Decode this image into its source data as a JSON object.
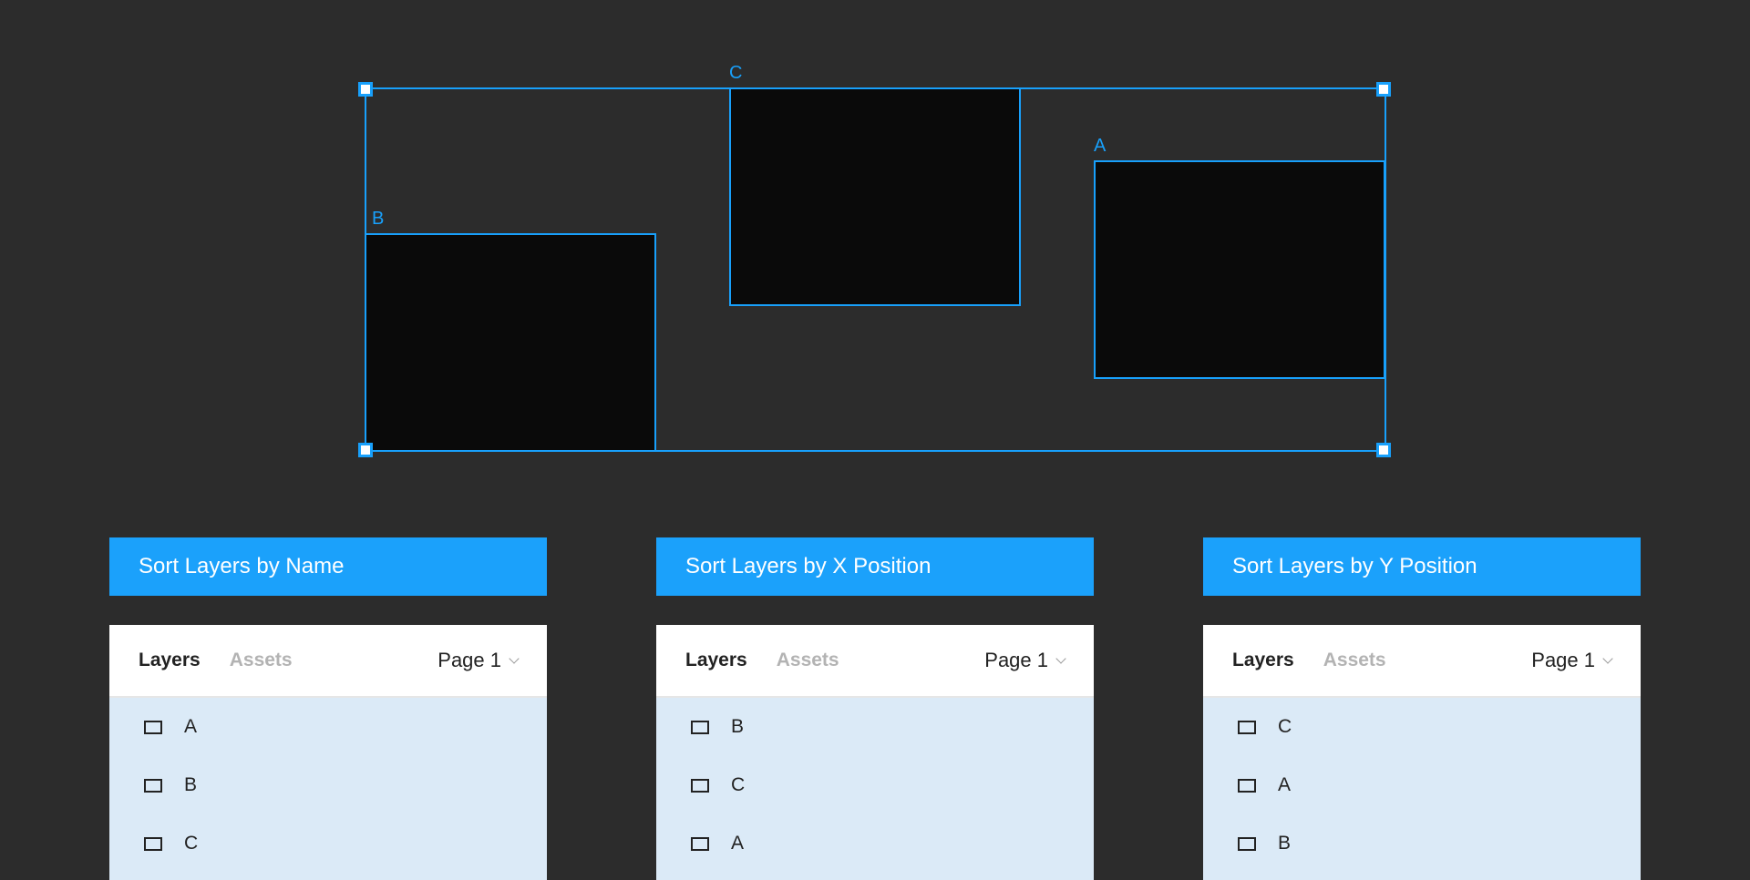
{
  "canvas": {
    "frames": [
      {
        "id": "frame-a",
        "label": "A"
      },
      {
        "id": "frame-b",
        "label": "B"
      },
      {
        "id": "frame-c",
        "label": "C"
      }
    ],
    "selection_color": "#18a0fb"
  },
  "panels": [
    {
      "title": "Sort Layers by Name",
      "tabs": {
        "layers": "Layers",
        "assets": "Assets"
      },
      "page": "Page 1",
      "layers": [
        "A",
        "B",
        "C"
      ]
    },
    {
      "title": "Sort Layers by X Position",
      "tabs": {
        "layers": "Layers",
        "assets": "Assets"
      },
      "page": "Page 1",
      "layers": [
        "B",
        "C",
        "A"
      ]
    },
    {
      "title": "Sort Layers by Y Position",
      "tabs": {
        "layers": "Layers",
        "assets": "Assets"
      },
      "page": "Page 1",
      "layers": [
        "C",
        "A",
        "B"
      ]
    }
  ],
  "colors": {
    "background": "#2c2c2c",
    "accent": "#18a0fb",
    "list_background": "#dbeaf7"
  }
}
